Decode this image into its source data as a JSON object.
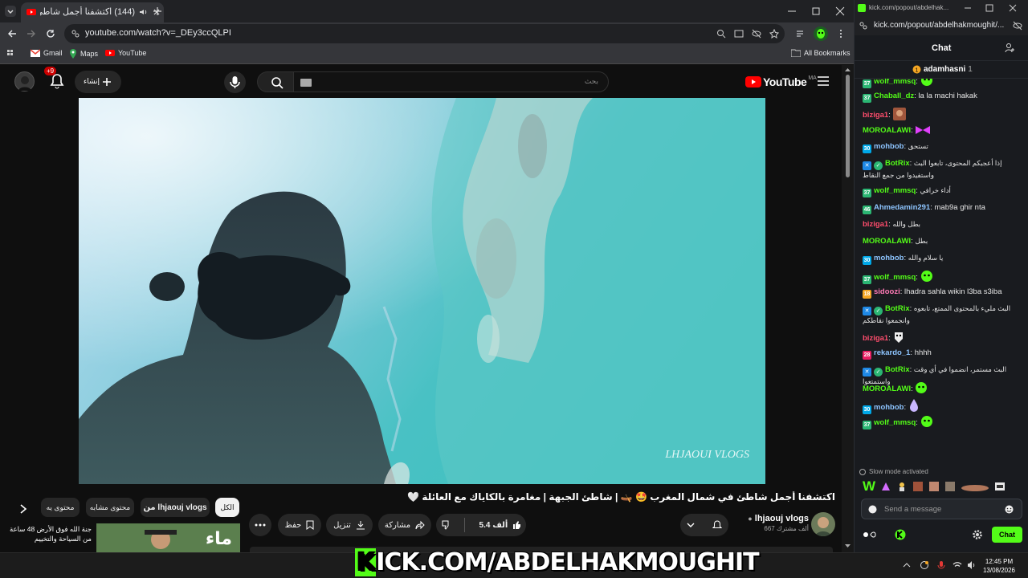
{
  "browser": {
    "tab_title": "(144) اكتشفنا أجمل شاطئ ف...",
    "url": "youtube.com/watch?v=_DEy3ccQLPI",
    "bookmarks": [
      "Gmail",
      "Maps",
      "YouTube"
    ],
    "all_bookmarks": "All Bookmarks"
  },
  "youtube": {
    "notif_count": "+9",
    "create_label": "إنشاء",
    "search_placeholder": "بحث",
    "logo": "YouTube",
    "region": "MA",
    "watermark": "LHJAOUI VLOGS",
    "video_title": "اكتشفنا أجمل شاطئ في شمال المغرب 🤩 🛶 | شاطئ الجبهة | مغامرة بالكاياك مع العائلة 🤍",
    "channel_name": "lhjaouj vlogs",
    "subscribers": "667 ألف مشترك",
    "like_count": "5.4 ألف",
    "share_label": "مشاركة",
    "download_label": "تنزيل",
    "save_label": "حفظ",
    "chips": [
      "الكل",
      "من lhjaouj vlogs",
      "محتوى مشابه",
      "محتوى يه"
    ],
    "next_video_title": "جنة الله فوق الأرض 48 ساعة من السياحة والتخييم",
    "next_thumb_text": "ماء"
  },
  "kick": {
    "window_url": "kick.com/popout/abdelhak...",
    "page_url": "kick.com/popout/abdelhakmoughit/...",
    "chat_title": "Chat",
    "pinned_user": "adamhasni",
    "pinned_count": "1",
    "messages": [
      {
        "badge": "37",
        "badge_color": "#2bb673",
        "user": "wolf_mmsq",
        "user_color": "#53fc18",
        "text": "",
        "emote": "green"
      },
      {
        "badge": "37",
        "badge_color": "#2bb673",
        "user": "Chaball_dz",
        "user_color": "#53fc18",
        "text": "la la machi hakak"
      },
      {
        "badge": "",
        "badge_color": "",
        "user": "biziga1",
        "user_color": "#ff4d6d",
        "text": "",
        "emote": "face"
      },
      {
        "badge": "",
        "badge_color": "",
        "user": "MOROALAWI",
        "user_color": "#53fc18",
        "text": "",
        "emote": "bow"
      },
      {
        "badge": "30",
        "badge_color": "#00a8e8",
        "user": "mohbob",
        "user_color": "#8ec5ff",
        "text": "تستحق"
      },
      {
        "badge": "bot",
        "badge_color": "#1e88e5",
        "user": "BotRix",
        "user_color": "#53fc18",
        "text": "إذا أعجبكم المحتوى، تابعوا البث واستفيدوا من جمع النقاط"
      },
      {
        "badge": "37",
        "badge_color": "#2bb673",
        "user": "wolf_mmsq",
        "user_color": "#53fc18",
        "text": "أداء خرافي"
      },
      {
        "badge": "46",
        "badge_color": "#2bb673",
        "user": "Ahmedamin291",
        "user_color": "#8ec5ff",
        "text": "mab9a ghir nta"
      },
      {
        "badge": "",
        "badge_color": "",
        "user": "biziga1",
        "user_color": "#ff4d6d",
        "text": "بطل والله"
      },
      {
        "badge": "",
        "badge_color": "",
        "user": "MOROALAWI",
        "user_color": "#53fc18",
        "text": "بطل"
      },
      {
        "badge": "30",
        "badge_color": "#00a8e8",
        "user": "mohbob",
        "user_color": "#8ec5ff",
        "text": "يا سلام والله"
      },
      {
        "badge": "37",
        "badge_color": "#2bb673",
        "user": "wolf_mmsq",
        "user_color": "#53fc18",
        "text": "",
        "emote": "green"
      },
      {
        "badge": "18",
        "badge_color": "#f5a623",
        "user": "sidoozi",
        "user_color": "#ff7ab6",
        "text": "lhadra sahla wikin l3ba s3iba"
      },
      {
        "badge": "bot",
        "badge_color": "#1e88e5",
        "user": "BotRix",
        "user_color": "#53fc18",
        "text": "البث مليء بالمحتوى الممتع، تابعوه وانجمعوا نقاطكم"
      },
      {
        "badge": "",
        "badge_color": "",
        "user": "biziga1",
        "user_color": "#ff4d6d",
        "text": "",
        "emote": "mask"
      },
      {
        "badge": "28",
        "badge_color": "#e91e63",
        "user": "rekardo_1",
        "user_color": "#8ec5ff",
        "text": "hhhh"
      },
      {
        "badge": "bot",
        "badge_color": "#1e88e5",
        "user": "BotRix",
        "user_color": "#53fc18",
        "text": "البث مستمر، انضموا في أي وقت واستمتعوا"
      },
      {
        "badge": "",
        "badge_color": "",
        "user": "MOROALAWI",
        "user_color": "#53fc18",
        "text": "",
        "emote": "green"
      },
      {
        "badge": "30",
        "badge_color": "#00a8e8",
        "user": "mohbob",
        "user_color": "#8ec5ff",
        "text": "",
        "emote": "drop"
      },
      {
        "badge": "37",
        "badge_color": "#2bb673",
        "user": "wolf_mmsq",
        "user_color": "#53fc18",
        "text": "",
        "emote": "green"
      }
    ],
    "slow_mode": "Slow mode activated",
    "send_placeholder": "Send a message",
    "chat_button": "Chat"
  },
  "overlay_text": {
    "k": "K",
    "rest": "ICK.COM/ABDELHAKMOUGHIT"
  },
  "taskbar": {
    "time": "12:45 PM",
    "date": "13/08/2026"
  },
  "colors": {
    "kick_green": "#53fc18",
    "youtube_red": "#ff0000"
  }
}
